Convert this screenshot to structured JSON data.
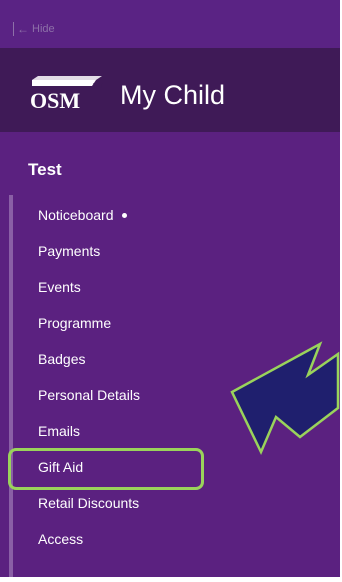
{
  "header": {
    "hide_label": "Hide",
    "brand_logo_text": "OSM",
    "app_title": "My Child"
  },
  "menu": {
    "group_title": "Test",
    "items": [
      {
        "label": "Noticeboard",
        "has_dot": true
      },
      {
        "label": "Payments"
      },
      {
        "label": "Events"
      },
      {
        "label": "Programme"
      },
      {
        "label": "Badges"
      },
      {
        "label": "Personal Details"
      },
      {
        "label": "Emails"
      },
      {
        "label": "Gift Aid",
        "highlighted": true
      },
      {
        "label": "Retail Discounts"
      },
      {
        "label": "Access"
      }
    ]
  },
  "colors": {
    "sidebar_bg": "#5b2180",
    "brand_bg": "#3f1a57",
    "highlight_outline": "#9ad35b",
    "pointer_fill": "#1f1f6e"
  },
  "icons": {
    "hide": "arrow-left-icon",
    "pointer": "callout-arrow-icon"
  }
}
